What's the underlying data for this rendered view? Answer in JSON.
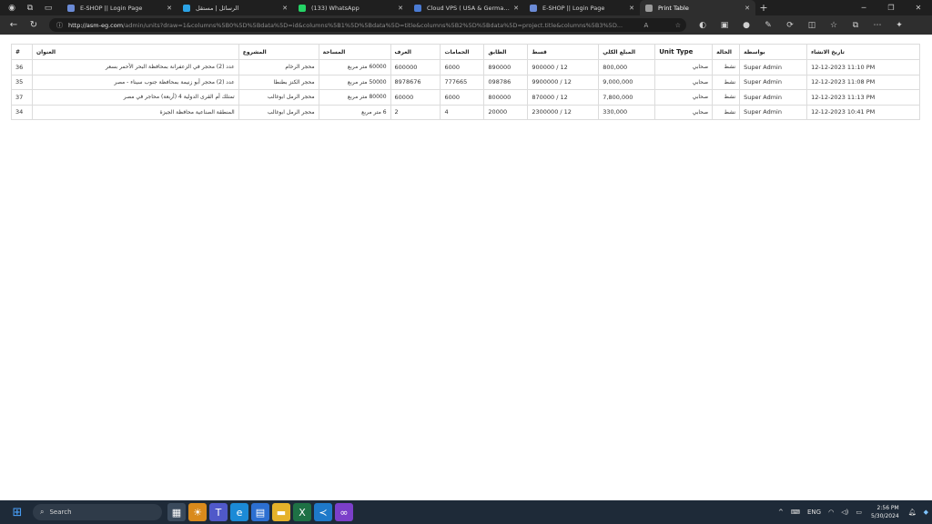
{
  "browser": {
    "tabs": [
      {
        "label": "E-SHOP || Login Page",
        "color": "#6b8bd6",
        "active": false
      },
      {
        "label": "الرسائل | مستقل",
        "color": "#2ba3e6",
        "active": false
      },
      {
        "label": "(133) WhatsApp",
        "color": "#25d366",
        "active": false
      },
      {
        "label": "Cloud VPS ( USA & Germany & I",
        "color": "#4a7bd4",
        "active": false
      },
      {
        "label": "E-SHOP || Login Page",
        "color": "#6b8bd6",
        "active": false
      },
      {
        "label": "Print Table",
        "color": "#9a9a9a",
        "active": true
      }
    ],
    "new_tab_label": "+",
    "address": {
      "host": "http://asm-eg.com",
      "path": "/admin/units?draw=1&columns%5B0%5D%5Bdata%5D=id&columns%5B1%5D%5Bdata%5D=title&columns%5B2%5D%5Bdata%5D=project.title&columns%5B3%5D..."
    }
  },
  "table": {
    "headers": [
      "#",
      "العنوان",
      "المشروع",
      "المساحة",
      "الغرف",
      "الحمامات",
      "الطابق",
      "قسط",
      "المبلغ الكلي",
      "Unit Type",
      "الحالة",
      "بواسطة",
      "تاريخ الانشاء"
    ],
    "rows": [
      [
        "36",
        "عدد (2) محجر في الزعفرانة بمحافظة البحر الأحمر بسعر",
        "محجر الرخام",
        "60000 متر مربع",
        "600000",
        "6000",
        "890000",
        "900000 / 12",
        "800,000",
        "صحابي",
        "نشط",
        "Super Admin",
        "12-12-2023 11:10 PM"
      ],
      [
        "35",
        "عدد (2) محجر أبو زنيمة بمحافظة جنوب سيناء - مصر",
        "محجر الكنز بطنطا",
        "50000 متر مربع",
        "8978676",
        "777665",
        "098786",
        "9900000 / 12",
        "9,000,000",
        "صحابي",
        "نشط",
        "Super Admin",
        "12-12-2023 11:08 PM"
      ],
      [
        "37",
        "تمتلك أم القرى الدولية 4 (أربعة) محاجر في مصر",
        "محجر الرمل ابوغالب",
        "80000 متر مربع",
        "60000",
        "6000",
        "800000",
        "870000 / 12",
        "7,800,000",
        "صحابي",
        "نشط",
        "Super Admin",
        "12-12-2023 11:13 PM"
      ],
      [
        "34",
        "المنطقة الصناعية محافظة الجيزة",
        "محجر الرمل ابوغالب",
        "6 متر مربع",
        "2",
        "4",
        "20000",
        "2300000 / 12",
        "330,000",
        "صحابي",
        "نشط",
        "Super Admin",
        "12-12-2023 10:41 PM"
      ]
    ]
  },
  "taskbar": {
    "search_placeholder": "Search",
    "language": "ENG",
    "time": "2:56 PM",
    "date": "5/30/2024"
  }
}
